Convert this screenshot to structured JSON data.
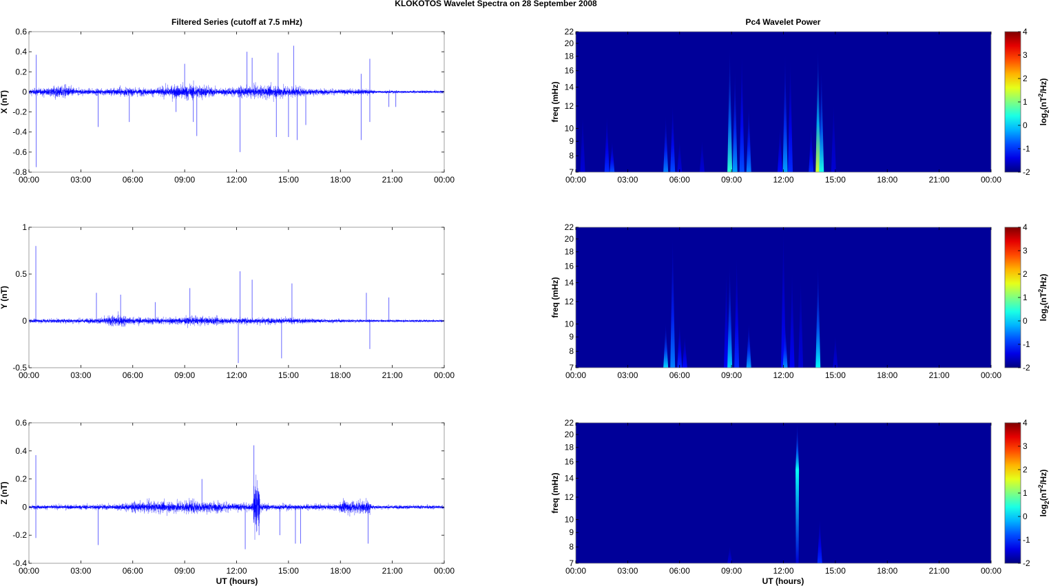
{
  "title": "KLOKOTOS Wavelet Spectra on 28 September 2008",
  "left_title": "Filtered Series (cutoff at 7.5 mHz)",
  "right_title": "Pc4 Wavelet Power",
  "xlabel": "UT (hours)",
  "colors": {
    "series": "#0000ff",
    "axis": "#000000"
  },
  "chart_data": [
    {
      "type": "line",
      "component": "X",
      "ylabel": "X (nT)",
      "xlim": [
        0,
        24
      ],
      "ylim": [
        -0.8,
        0.6
      ],
      "xticks": [
        "00:00",
        "03:00",
        "06:00",
        "09:00",
        "12:00",
        "15:00",
        "18:00",
        "21:00",
        "00:00"
      ],
      "yticks": [
        -0.8,
        -0.6,
        -0.4,
        -0.2,
        0,
        0.2,
        0.4,
        0.6
      ],
      "noise_envelope": [
        [
          0,
          0.04
        ],
        [
          1,
          0.06
        ],
        [
          2,
          0.1
        ],
        [
          2.8,
          0.05
        ],
        [
          4,
          0.04
        ],
        [
          5.5,
          0.07
        ],
        [
          7,
          0.05
        ],
        [
          9,
          0.12
        ],
        [
          10,
          0.1
        ],
        [
          11,
          0.05
        ],
        [
          12,
          0.07
        ],
        [
          14.3,
          0.1
        ],
        [
          15.5,
          0.07
        ],
        [
          17,
          0.04
        ],
        [
          19.5,
          0.04
        ],
        [
          20,
          0.02
        ],
        [
          24,
          0.02
        ]
      ],
      "spikes": [
        [
          0.42,
          0.37
        ],
        [
          0.42,
          -0.75
        ],
        [
          4,
          -0.35
        ],
        [
          5.8,
          -0.3
        ],
        [
          8.5,
          -0.2
        ],
        [
          9,
          0.28
        ],
        [
          9.5,
          -0.3
        ],
        [
          9.7,
          -0.44
        ],
        [
          12.2,
          -0.6
        ],
        [
          12.6,
          0.4
        ],
        [
          12.9,
          0.34
        ],
        [
          14.3,
          -0.45
        ],
        [
          14.4,
          0.39
        ],
        [
          15,
          -0.45
        ],
        [
          15.3,
          0.46
        ],
        [
          15.5,
          -0.48
        ],
        [
          16,
          -0.33
        ],
        [
          19.2,
          -0.48
        ],
        [
          19.2,
          0.18
        ],
        [
          19.7,
          0.33
        ],
        [
          19.7,
          -0.3
        ],
        [
          20.8,
          -0.15
        ],
        [
          21.2,
          -0.15
        ]
      ]
    },
    {
      "type": "line",
      "component": "Y",
      "ylabel": "Y (nT)",
      "xlim": [
        0,
        24
      ],
      "ylim": [
        -0.5,
        1
      ],
      "xticks": [
        "00:00",
        "03:00",
        "06:00",
        "09:00",
        "12:00",
        "15:00",
        "18:00",
        "21:00",
        "00:00"
      ],
      "yticks": [
        -0.5,
        0,
        0.5,
        1
      ],
      "noise_envelope": [
        [
          0,
          0.03
        ],
        [
          4,
          0.04
        ],
        [
          5,
          0.1
        ],
        [
          6,
          0.06
        ],
        [
          8,
          0.05
        ],
        [
          9.5,
          0.07
        ],
        [
          12,
          0.05
        ],
        [
          14.5,
          0.05
        ],
        [
          17,
          0.03
        ],
        [
          20,
          0.02
        ],
        [
          24,
          0.02
        ]
      ],
      "spikes": [
        [
          0.4,
          0.8
        ],
        [
          3.9,
          0.3
        ],
        [
          5.3,
          0.28
        ],
        [
          7.3,
          0.2
        ],
        [
          9.3,
          0.35
        ],
        [
          12.1,
          -0.45
        ],
        [
          12.2,
          0.53
        ],
        [
          12.9,
          0.44
        ],
        [
          14.6,
          -0.4
        ],
        [
          15.2,
          0.4
        ],
        [
          19.5,
          0.3
        ],
        [
          19.7,
          -0.3
        ],
        [
          20.8,
          0.25
        ]
      ]
    },
    {
      "type": "line",
      "component": "Z",
      "ylabel": "Z (nT)",
      "xlim": [
        0,
        24
      ],
      "ylim": [
        -0.4,
        0.6
      ],
      "xticks": [
        "00:00",
        "03:00",
        "06:00",
        "09:00",
        "12:00",
        "15:00",
        "18:00",
        "21:00",
        "00:00"
      ],
      "yticks": [
        -0.4,
        -0.2,
        0,
        0.2,
        0.4,
        0.6
      ],
      "noise_envelope": [
        [
          0,
          0.02
        ],
        [
          5,
          0.03
        ],
        [
          6,
          0.05
        ],
        [
          9.5,
          0.07
        ],
        [
          12,
          0.04
        ],
        [
          12.95,
          0.04
        ],
        [
          13,
          0.3
        ],
        [
          13.3,
          0.3
        ],
        [
          13.35,
          0.04
        ],
        [
          14,
          0.03
        ],
        [
          17.9,
          0.03
        ],
        [
          18,
          0.07
        ],
        [
          19.7,
          0.07
        ],
        [
          19.8,
          0.02
        ],
        [
          24,
          0.02
        ]
      ],
      "spikes": [
        [
          0.4,
          0.37
        ],
        [
          0.4,
          -0.22
        ],
        [
          4,
          -0.27
        ],
        [
          10,
          0.2
        ],
        [
          12.5,
          -0.3
        ],
        [
          13,
          0.44
        ],
        [
          13.3,
          -0.2
        ],
        [
          14.5,
          -0.2
        ],
        [
          15.4,
          -0.26
        ],
        [
          15.7,
          -0.26
        ],
        [
          19.6,
          -0.26
        ]
      ]
    },
    {
      "type": "heatmap",
      "component": "X",
      "ylabel": "freq (mHz)",
      "xlim": [
        0,
        24
      ],
      "ylim": [
        7,
        22
      ],
      "yscale": "log",
      "yticks": [
        7,
        8,
        9,
        10,
        12,
        14,
        16,
        18,
        20,
        22
      ],
      "clim": [
        -2,
        4
      ],
      "colorbar_ticks": [
        -2,
        -1,
        0,
        1,
        2,
        3,
        4
      ],
      "streaks": [
        [
          0.4,
          11,
          7,
          -1.5
        ],
        [
          1.8,
          11,
          7,
          -1
        ],
        [
          2.1,
          9,
          7,
          -0.8
        ],
        [
          5.2,
          11,
          7,
          -0.5
        ],
        [
          5.6,
          12,
          7,
          -0.8
        ],
        [
          6,
          9,
          7,
          -1.5
        ],
        [
          7.3,
          9,
          7,
          -1.5
        ],
        [
          8.9,
          19,
          7,
          0.5
        ],
        [
          9.2,
          16,
          7,
          -0.3
        ],
        [
          9.6,
          18,
          7,
          -0.8
        ],
        [
          10,
          12,
          7,
          -0.5
        ],
        [
          11.8,
          10,
          7,
          -1.2
        ],
        [
          12.1,
          18,
          7,
          -0.3
        ],
        [
          12.4,
          17,
          7,
          -1
        ],
        [
          13.6,
          10,
          7,
          -1
        ],
        [
          14,
          19,
          7,
          1.5
        ],
        [
          14.2,
          16,
          7,
          0.4
        ],
        [
          14.9,
          12,
          7,
          -1.5
        ]
      ]
    },
    {
      "type": "heatmap",
      "component": "Y",
      "ylabel": "freq (mHz)",
      "xlim": [
        0,
        24
      ],
      "ylim": [
        7,
        22
      ],
      "yscale": "log",
      "yticks": [
        7,
        8,
        9,
        10,
        12,
        14,
        16,
        18,
        20,
        22
      ],
      "clim": [
        -2,
        4
      ],
      "colorbar_ticks": [
        -2,
        -1,
        0,
        1,
        2,
        3,
        4
      ],
      "streaks": [
        [
          5.2,
          10,
          7,
          0
        ],
        [
          5.6,
          20,
          7,
          -0.5
        ],
        [
          6,
          10,
          7,
          -1
        ],
        [
          6.3,
          9,
          7,
          -1.2
        ],
        [
          8.7,
          15,
          7,
          -1.3
        ],
        [
          8.9,
          16,
          7,
          0
        ],
        [
          9.3,
          17,
          7,
          -1
        ],
        [
          10,
          10,
          7,
          -0.3
        ],
        [
          12,
          21,
          7,
          -1.2
        ],
        [
          12.1,
          10,
          7,
          -0.4
        ],
        [
          12.5,
          15,
          7,
          -1.3
        ],
        [
          13,
          14,
          7,
          -1.5
        ],
        [
          14,
          16,
          7,
          0.2
        ],
        [
          15,
          9,
          7,
          -1.5
        ]
      ]
    },
    {
      "type": "heatmap",
      "component": "Z",
      "ylabel": "freq (mHz)",
      "xlim": [
        0,
        24
      ],
      "ylim": [
        7,
        22
      ],
      "yscale": "log",
      "yticks": [
        7,
        8,
        9,
        10,
        12,
        14,
        16,
        18,
        20,
        22
      ],
      "clim": [
        -2,
        4
      ],
      "colorbar_ticks": [
        -2,
        -1,
        0,
        1,
        2,
        3,
        4
      ],
      "streaks": [
        [
          8.9,
          8,
          7,
          -1.5
        ],
        [
          12.8,
          22,
          15,
          0.3
        ],
        [
          14.1,
          10,
          7,
          -1
        ]
      ]
    }
  ],
  "colorbar_label": {
    "base": "log",
    "sub": "2",
    "mid": "(nT",
    "sup": "2",
    "end": "/Hz)"
  }
}
